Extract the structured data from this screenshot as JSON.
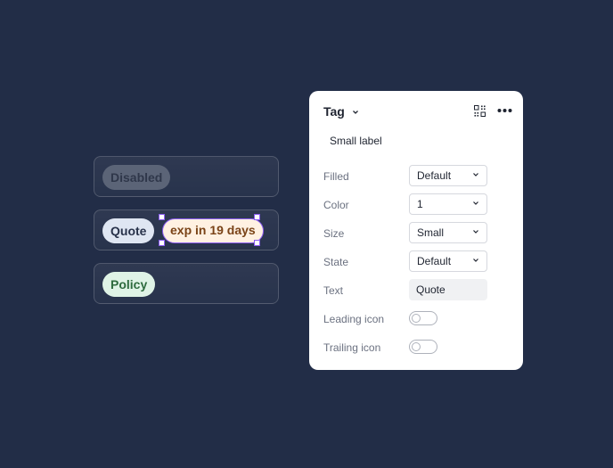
{
  "tags": {
    "disabled": "Disabled",
    "quote": "Quote",
    "expiry": "exp in 19 days",
    "policy": "Policy"
  },
  "panel": {
    "title": "Tag",
    "subtitle": "Small label",
    "properties": {
      "filled": {
        "label": "Filled",
        "value": "Default"
      },
      "color": {
        "label": "Color",
        "value": "1"
      },
      "size": {
        "label": "Size",
        "value": "Small"
      },
      "state": {
        "label": "State",
        "value": "Default"
      },
      "text": {
        "label": "Text",
        "value": "Quote"
      },
      "leading_icon": {
        "label": "Leading icon",
        "on": false
      },
      "trailing_icon": {
        "label": "Trailing icon",
        "on": false
      }
    },
    "icons": [
      "chevron-down-icon",
      "component-grid-icon",
      "more-horizontal-icon"
    ]
  },
  "colors": {
    "background": "#222d47",
    "selection": "#8a5cf0",
    "quote_tag": "#dfe6f2",
    "expiry_tag": "#fff1e2",
    "policy_tag": "#dff3e6",
    "disabled_tag": "#5b6477"
  }
}
